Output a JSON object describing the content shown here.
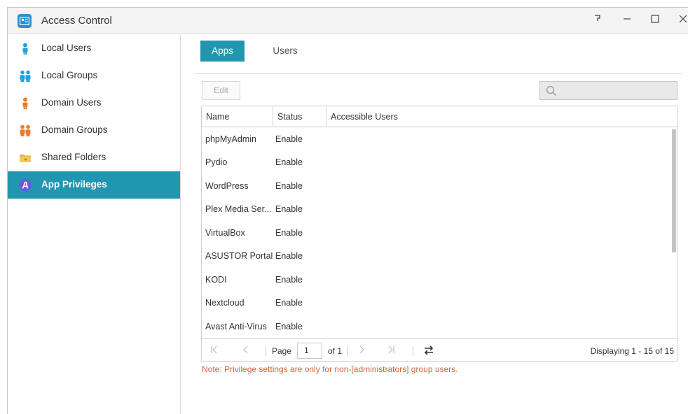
{
  "window": {
    "title": "Access Control",
    "controls": {
      "help": "ʔ",
      "minimize": "—",
      "maximize": "☐",
      "close": "✕"
    }
  },
  "sidebar": {
    "items": [
      {
        "label": "Local Users",
        "icon": "user-icon",
        "color": "#1ea3e0"
      },
      {
        "label": "Local Groups",
        "icon": "group-icon",
        "color": "#1ea3e0"
      },
      {
        "label": "Domain Users",
        "icon": "domain-user-icon",
        "color": "#f07a2a"
      },
      {
        "label": "Domain Groups",
        "icon": "domain-group-icon",
        "color": "#f07a2a"
      },
      {
        "label": "Shared Folders",
        "icon": "folder-icon",
        "color": "#e6b23a"
      },
      {
        "label": "App Privileges",
        "icon": "app-privileges-icon",
        "color": "#6a5ad8",
        "active": true
      }
    ]
  },
  "tabs": {
    "apps": "Apps",
    "users": "Users",
    "active": "Apps"
  },
  "toolbar": {
    "edit_label": "Edit",
    "search_placeholder": ""
  },
  "table": {
    "columns": [
      "Name",
      "Status",
      "Accessible Users"
    ],
    "rows": [
      {
        "name": "phpMyAdmin",
        "status": "Enable",
        "users": ""
      },
      {
        "name": "Pydio",
        "status": "Enable",
        "users": ""
      },
      {
        "name": "WordPress",
        "status": "Enable",
        "users": ""
      },
      {
        "name": "Plex Media Ser...",
        "status": "Enable",
        "users": ""
      },
      {
        "name": "VirtualBox",
        "status": "Enable",
        "users": ""
      },
      {
        "name": "ASUSTOR Portal",
        "status": "Enable",
        "users": ""
      },
      {
        "name": "KODI",
        "status": "Enable",
        "users": ""
      },
      {
        "name": "Nextcloud",
        "status": "Enable",
        "users": ""
      },
      {
        "name": "Avast Anti-Virus",
        "status": "Enable",
        "users": ""
      }
    ]
  },
  "pager": {
    "page_label": "Page",
    "page_value": "1",
    "of_label": "of 1",
    "status": "Displaying 1 - 15 of 15"
  },
  "note": "Note: Privilege settings are only for non-[administrators] group users.",
  "colors": {
    "accent": "#2196b0",
    "note": "#d2623a"
  }
}
